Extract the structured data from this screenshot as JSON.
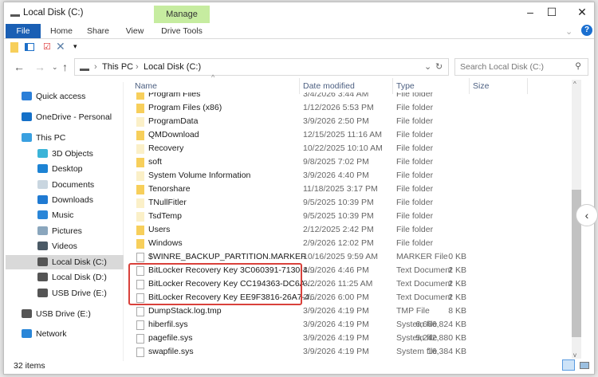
{
  "window": {
    "title": "Local Disk (C:)",
    "contextual_tab": "Manage"
  },
  "ribbon": {
    "tabs": [
      "File",
      "Home",
      "Share",
      "View",
      "Drive Tools"
    ]
  },
  "address": {
    "path": [
      "This PC",
      "Local Disk (C:)"
    ],
    "search_placeholder": "Search Local Disk (C:)"
  },
  "sidebar": {
    "items": [
      {
        "label": "Quick access",
        "icon": "star-icon",
        "color": "#2b7fd8"
      },
      {
        "label": "OneDrive - Personal",
        "icon": "cloud-icon",
        "color": "#1470c8"
      },
      {
        "label": "This PC",
        "icon": "computer-icon",
        "color": "#3aa0e0"
      },
      {
        "label": "3D Objects",
        "icon": "cube-icon",
        "color": "#3bb4d8"
      },
      {
        "label": "Desktop",
        "icon": "desktop-icon",
        "color": "#1d83d4"
      },
      {
        "label": "Documents",
        "icon": "document-icon",
        "color": "#c9d6e0"
      },
      {
        "label": "Downloads",
        "icon": "download-icon",
        "color": "#1f7ad2"
      },
      {
        "label": "Music",
        "icon": "music-icon",
        "color": "#2a86d8"
      },
      {
        "label": "Pictures",
        "icon": "pictures-icon",
        "color": "#8aa6bd"
      },
      {
        "label": "Videos",
        "icon": "video-icon",
        "color": "#4b5a66"
      },
      {
        "label": "Local Disk (C:)",
        "icon": "drive-icon",
        "color": "#555",
        "selected": true
      },
      {
        "label": "Local Disk (D:)",
        "icon": "drive-icon",
        "color": "#555"
      },
      {
        "label": "USB Drive (E:)",
        "icon": "drive-icon",
        "color": "#555"
      },
      {
        "label": "USB Drive (E:)",
        "icon": "drive-icon",
        "color": "#555"
      },
      {
        "label": "Network",
        "icon": "network-icon",
        "color": "#2a86d8"
      }
    ]
  },
  "columns": [
    "Name",
    "Date modified",
    "Type",
    "Size"
  ],
  "files": [
    {
      "name": "Program Files",
      "date": "3/4/2026 3:44 AM",
      "type": "File folder",
      "size": "",
      "icon": "folder"
    },
    {
      "name": "Program Files (x86)",
      "date": "1/12/2026 5:53 PM",
      "type": "File folder",
      "size": "",
      "icon": "folder"
    },
    {
      "name": "ProgramData",
      "date": "3/9/2026 2:50 PM",
      "type": "File folder",
      "size": "",
      "icon": "folderl"
    },
    {
      "name": "QMDownload",
      "date": "12/15/2025 11:16 AM",
      "type": "File folder",
      "size": "",
      "icon": "folder"
    },
    {
      "name": "Recovery",
      "date": "10/22/2025 10:10 AM",
      "type": "File folder",
      "size": "",
      "icon": "folderl"
    },
    {
      "name": "soft",
      "date": "9/8/2025 7:02 PM",
      "type": "File folder",
      "size": "",
      "icon": "folder"
    },
    {
      "name": "System Volume Information",
      "date": "3/9/2026 4:40 PM",
      "type": "File folder",
      "size": "",
      "icon": "folderl"
    },
    {
      "name": "Tenorshare",
      "date": "11/18/2025 3:17 PM",
      "type": "File folder",
      "size": "",
      "icon": "folder"
    },
    {
      "name": "TNullFitler",
      "date": "9/5/2025 10:39 PM",
      "type": "File folder",
      "size": "",
      "icon": "folderl"
    },
    {
      "name": "TsdTemp",
      "date": "9/5/2025 10:39 PM",
      "type": "File folder",
      "size": "",
      "icon": "folderl"
    },
    {
      "name": "Users",
      "date": "2/12/2025 2:42 PM",
      "type": "File folder",
      "size": "",
      "icon": "folder"
    },
    {
      "name": "Windows",
      "date": "2/9/2026 12:02 PM",
      "type": "File folder",
      "size": "",
      "icon": "folder"
    },
    {
      "name": "$WINRE_BACKUP_PARTITION.MARKER",
      "date": "10/16/2025 9:59 AM",
      "type": "MARKER File",
      "size": "0 KB",
      "icon": "doc"
    },
    {
      "name": "BitLocker Recovery Key 3C060391-7130-4...",
      "date": "3/9/2026 4:46 PM",
      "type": "Text Document",
      "size": "2 KB",
      "icon": "doc"
    },
    {
      "name": "BitLocker Recovery Key CC194363-DC6A-...",
      "date": "3/2/2026 11:25 AM",
      "type": "Text Document",
      "size": "2 KB",
      "icon": "doc"
    },
    {
      "name": "BitLocker Recovery Key EE9F3816-26A7-4...",
      "date": "2/6/2026 6:00 PM",
      "type": "Text Document",
      "size": "2 KB",
      "icon": "doc"
    },
    {
      "name": "DumpStack.log.tmp",
      "date": "3/9/2026 4:19 PM",
      "type": "TMP File",
      "size": "8 KB",
      "icon": "doc"
    },
    {
      "name": "hiberfil.sys",
      "date": "3/9/2026 4:19 PM",
      "type": "System file",
      "size": "6,666,824 KB",
      "icon": "doc"
    },
    {
      "name": "pagefile.sys",
      "date": "3/9/2026 4:19 PM",
      "type": "System file",
      "size": "5,242,880 KB",
      "icon": "doc"
    },
    {
      "name": "swapfile.sys",
      "date": "3/9/2026 4:19 PM",
      "type": "System file",
      "size": "16,384 KB",
      "icon": "doc"
    }
  ],
  "status": {
    "count": "32 items"
  },
  "highlight_color": "#d9413b"
}
